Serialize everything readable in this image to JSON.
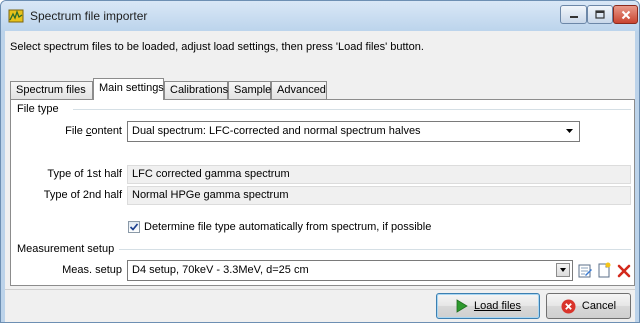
{
  "window": {
    "title": "Spectrum file importer",
    "icon": "spectrum-app-icon"
  },
  "instruction": "Select spectrum files to be loaded, adjust load settings, then press 'Load files' button.",
  "tabs": [
    {
      "label": "Spectrum files",
      "active": false
    },
    {
      "label": "Main settings",
      "active": true
    },
    {
      "label": "Calibrations",
      "active": false
    },
    {
      "label": "Sample",
      "active": false
    },
    {
      "label": "Advanced",
      "active": false
    }
  ],
  "file_type": {
    "group_label": "File type",
    "content_label": "File content",
    "content_value": "Dual spectrum: LFC-corrected and normal spectrum halves",
    "first_half_label": "Type of 1st half",
    "first_half_value": "LFC corrected gamma spectrum",
    "second_half_label": "Type of 2nd half",
    "second_half_value": "Normal HPGe gamma spectrum",
    "auto_detect_label": "Determine file type automatically from spectrum, if possible",
    "auto_detect_checked": true
  },
  "measurement": {
    "group_label": "Measurement setup",
    "setup_label": "Meas. setup",
    "setup_value": "D4 setup, 70keV - 3.3MeV, d=25 cm"
  },
  "buttons": {
    "load_label": "Load files",
    "cancel_label": "Cancel"
  },
  "colors": {
    "accent_green": "#2e9a2e",
    "delete_red": "#d3291c",
    "cancel_red": "#d9342b"
  }
}
